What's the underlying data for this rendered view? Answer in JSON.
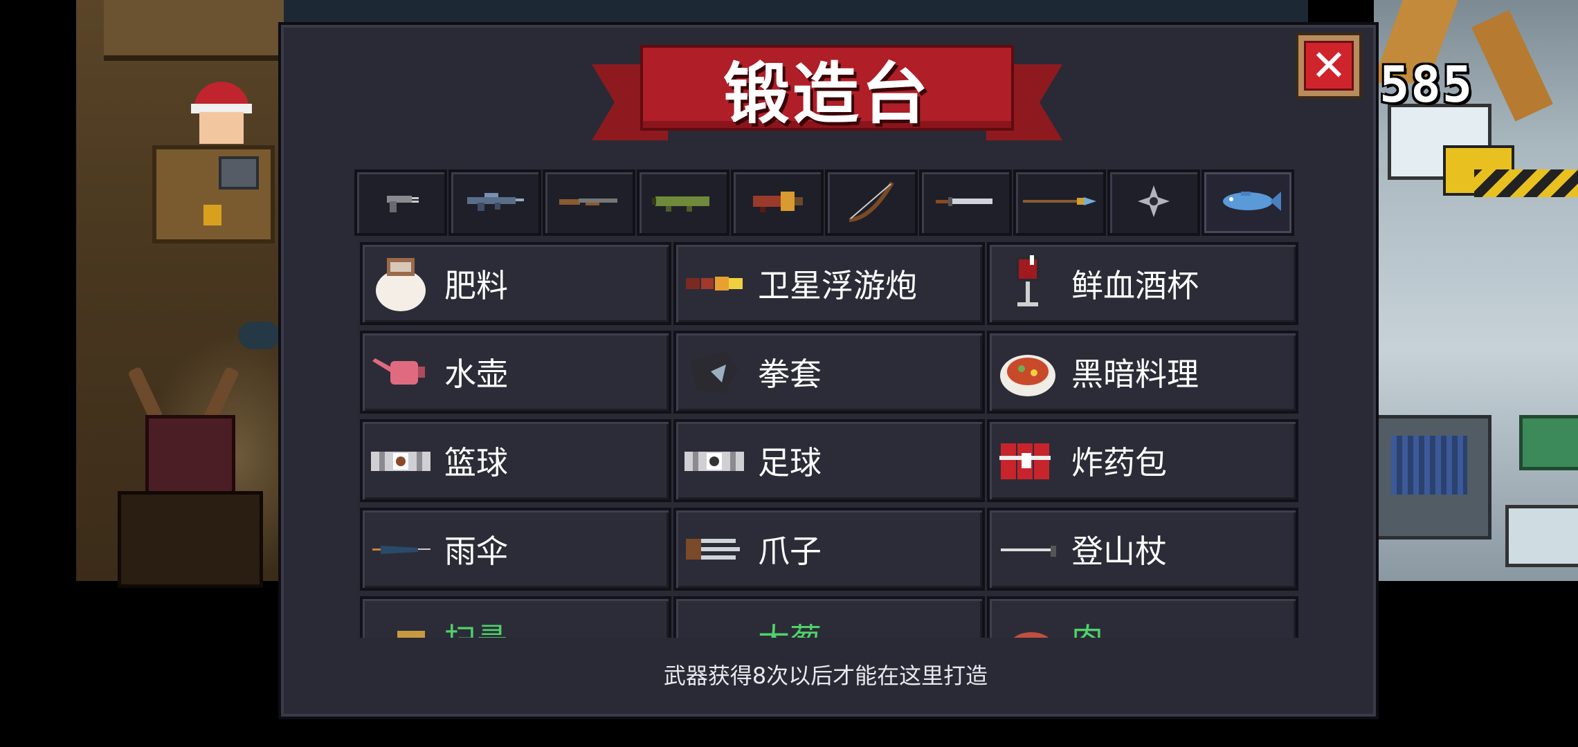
{
  "title": "锻造台",
  "coins": "585",
  "close_icon": "close-x-icon",
  "hint": "武器获得8次以后才能在这里打造",
  "tabs": [
    {
      "icon": "pistol-icon"
    },
    {
      "icon": "assault-rifle-icon"
    },
    {
      "icon": "shotgun-icon"
    },
    {
      "icon": "launcher-icon"
    },
    {
      "icon": "heavy-gun-icon"
    },
    {
      "icon": "bow-icon"
    },
    {
      "icon": "sword-icon"
    },
    {
      "icon": "spear-icon"
    },
    {
      "icon": "shuriken-icon"
    },
    {
      "icon": "fish-icon",
      "active": true
    }
  ],
  "items": [
    {
      "label": "肥料",
      "icon": "fertilizer-bag-icon"
    },
    {
      "label": "卫星浮游炮",
      "icon": "satellite-cannon-icon"
    },
    {
      "label": "鲜血酒杯",
      "icon": "blood-goblet-icon"
    },
    {
      "label": "水壶",
      "icon": "watering-can-icon"
    },
    {
      "label": "拳套",
      "icon": "gauntlet-icon"
    },
    {
      "label": "黑暗料理",
      "icon": "dark-dish-icon"
    },
    {
      "label": "篮球",
      "icon": "basketball-icon"
    },
    {
      "label": "足球",
      "icon": "soccer-ball-icon"
    },
    {
      "label": "炸药包",
      "icon": "dynamite-pack-icon"
    },
    {
      "label": "雨伞",
      "icon": "umbrella-icon"
    },
    {
      "label": "爪子",
      "icon": "claw-icon"
    },
    {
      "label": "登山杖",
      "icon": "hiking-stick-icon"
    },
    {
      "label": "扫帚",
      "icon": "broom-icon",
      "locked": true
    },
    {
      "label": "大葱",
      "icon": "leek-icon",
      "locked": true
    },
    {
      "label": "肉",
      "icon": "meat-icon",
      "locked": true
    }
  ],
  "colors": {
    "dialog_bg": "#2a2a36",
    "banner_red": "#b01e27",
    "close_red": "#d0242c",
    "locked_text": "#4fd26a"
  }
}
